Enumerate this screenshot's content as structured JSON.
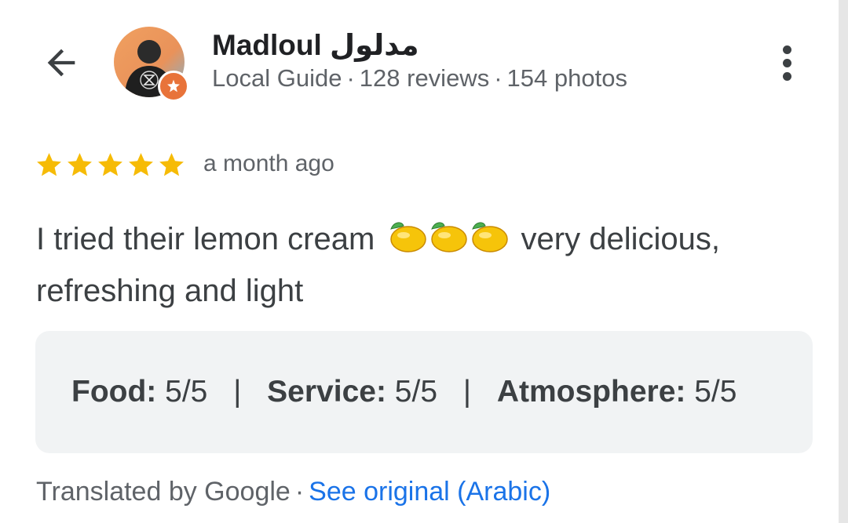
{
  "header": {
    "user_name": "Madloul مدلول",
    "meta": {
      "role": "Local Guide",
      "reviews": "128 reviews",
      "photos": "154 photos",
      "separator": "·"
    },
    "icons": {
      "back": "arrow-left-icon",
      "more": "more-vertical-icon",
      "badge": "local-guide-star-icon"
    }
  },
  "review": {
    "rating": 5,
    "max_rating": 5,
    "time": "a month ago",
    "text_before": "I tried their lemon cream",
    "emoji": "🍋🍋🍋",
    "text_after": "very delicious, refreshing and light"
  },
  "ratings": {
    "items": [
      {
        "label": "Food:",
        "value": "5/5"
      },
      {
        "label": "Service:",
        "value": "5/5"
      },
      {
        "label": "Atmosphere:",
        "value": "5/5"
      }
    ],
    "divider": "|"
  },
  "footer": {
    "translated": "Translated by Google",
    "separator": "·",
    "see_original": "See original (Arabic)"
  },
  "colors": {
    "star": "#f6bb06",
    "link": "#1a73e8",
    "badge": "#e8733a",
    "box_bg": "#f1f3f4"
  }
}
